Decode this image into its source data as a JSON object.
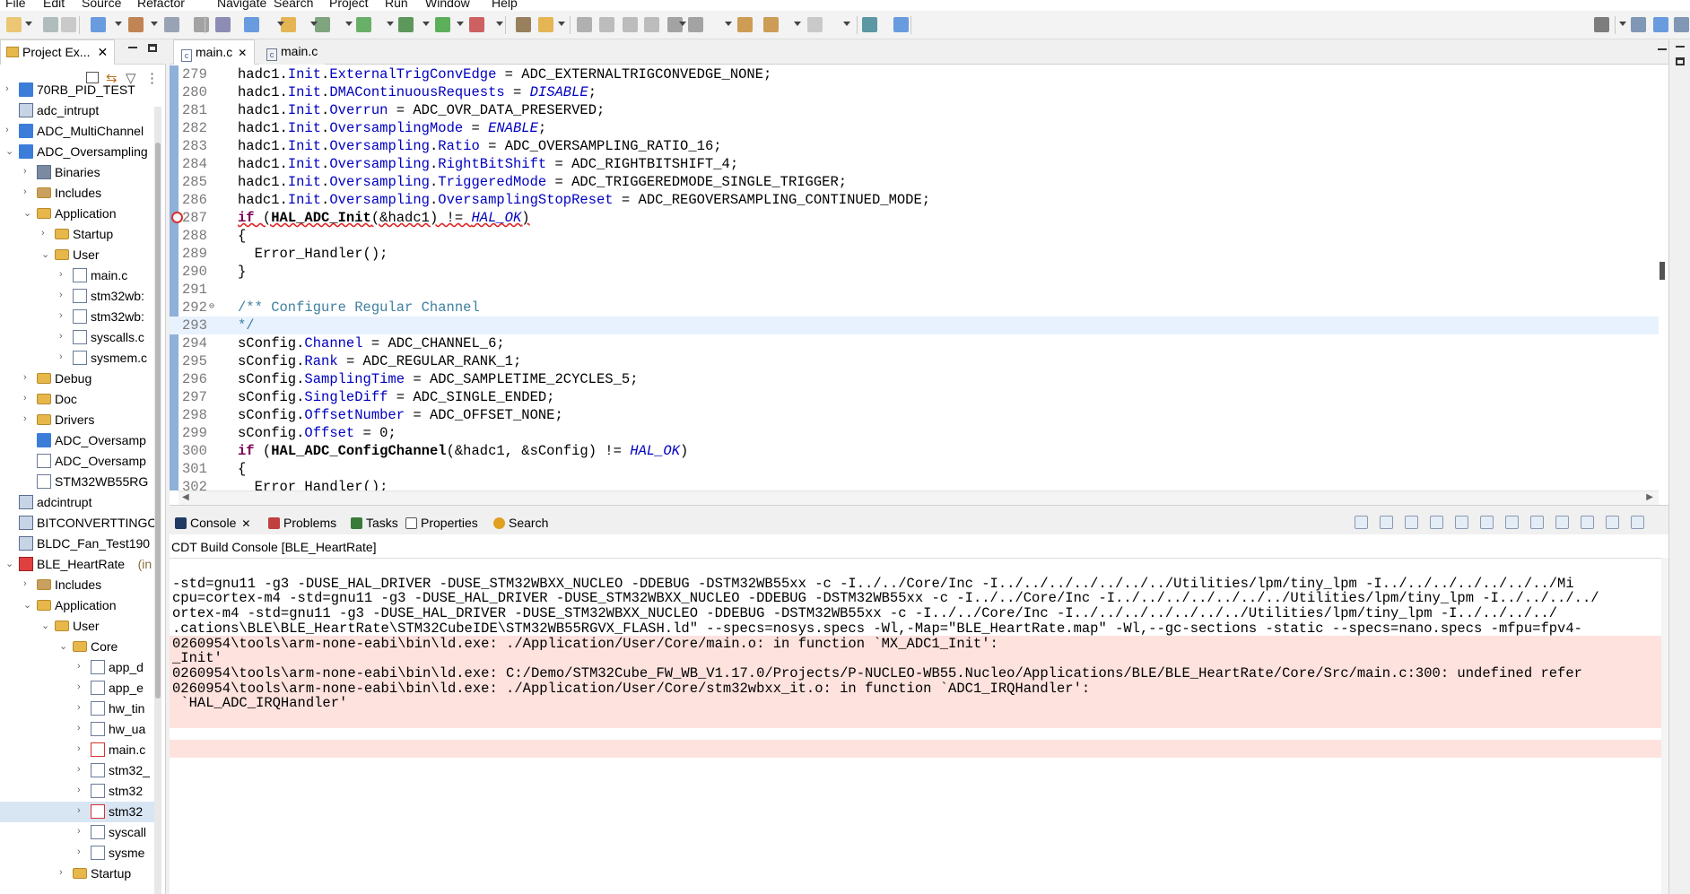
{
  "menu": [
    "File",
    "Edit",
    "Source",
    "Refactor",
    "Navigate",
    "Search",
    "Project",
    "Run",
    "Window",
    "Help"
  ],
  "explorer": {
    "tab_label": "Project Ex...",
    "items": [
      {
        "label": "70RB_PID_TEST",
        "indent": 0,
        "twisty": "›",
        "icon": "ide"
      },
      {
        "label": "adc_intrupt",
        "indent": 0,
        "twisty": "",
        "icon": "proj"
      },
      {
        "label": "ADC_MultiChannel",
        "indent": 0,
        "twisty": "›",
        "icon": "ide"
      },
      {
        "label": "ADC_Oversampling",
        "indent": 0,
        "twisty": "⌄",
        "icon": "ide"
      },
      {
        "label": "Binaries",
        "indent": 1,
        "twisty": "›",
        "icon": "bin"
      },
      {
        "label": "Includes",
        "indent": 1,
        "twisty": "›",
        "icon": "inc"
      },
      {
        "label": "Application",
        "indent": 1,
        "twisty": "⌄",
        "icon": "folder"
      },
      {
        "label": "Startup",
        "indent": 2,
        "twisty": "›",
        "icon": "folder"
      },
      {
        "label": "User",
        "indent": 2,
        "twisty": "⌄",
        "icon": "folder"
      },
      {
        "label": "main.c",
        "indent": 3,
        "twisty": "›",
        "icon": "cfile"
      },
      {
        "label": "stm32wb:",
        "indent": 3,
        "twisty": "›",
        "icon": "cfile"
      },
      {
        "label": "stm32wb:",
        "indent": 3,
        "twisty": "›",
        "icon": "cfile"
      },
      {
        "label": "syscalls.c",
        "indent": 3,
        "twisty": "›",
        "icon": "cfile"
      },
      {
        "label": "sysmem.c",
        "indent": 3,
        "twisty": "›",
        "icon": "cfile"
      },
      {
        "label": "Debug",
        "indent": 1,
        "twisty": "›",
        "icon": "folder"
      },
      {
        "label": "Doc",
        "indent": 1,
        "twisty": "›",
        "icon": "folder"
      },
      {
        "label": "Drivers",
        "indent": 1,
        "twisty": "›",
        "icon": "folder"
      },
      {
        "label": "ADC_Oversamp",
        "indent": 1,
        "twisty": "",
        "icon": "mx"
      },
      {
        "label": "ADC_Oversamp",
        "indent": 1,
        "twisty": "",
        "icon": "doc"
      },
      {
        "label": "STM32WB55RG",
        "indent": 1,
        "twisty": "",
        "icon": "doc"
      },
      {
        "label": "adcintrupt",
        "indent": 0,
        "twisty": "",
        "icon": "proj"
      },
      {
        "label": "BITCONVERTTINGC",
        "indent": 0,
        "twisty": "",
        "icon": "proj"
      },
      {
        "label": "BLDC_Fan_Test190",
        "indent": 0,
        "twisty": "",
        "icon": "proj"
      },
      {
        "label": "BLE_HeartRate",
        "indent": 0,
        "twisty": "⌄",
        "icon": "errproj",
        "decoration": "(in"
      },
      {
        "label": "Includes",
        "indent": 1,
        "twisty": "›",
        "icon": "inc"
      },
      {
        "label": "Application",
        "indent": 1,
        "twisty": "⌄",
        "icon": "folder"
      },
      {
        "label": "User",
        "indent": 2,
        "twisty": "⌄",
        "icon": "folder"
      },
      {
        "label": "Core",
        "indent": 3,
        "twisty": "⌄",
        "icon": "folder"
      },
      {
        "label": "app_d",
        "indent": 4,
        "twisty": "›",
        "icon": "cfile"
      },
      {
        "label": "app_e",
        "indent": 4,
        "twisty": "›",
        "icon": "cfile"
      },
      {
        "label": "hw_tin",
        "indent": 4,
        "twisty": "›",
        "icon": "cfile"
      },
      {
        "label": "hw_ua",
        "indent": 4,
        "twisty": "›",
        "icon": "cfile"
      },
      {
        "label": "main.c",
        "indent": 4,
        "twisty": "›",
        "icon": "cerr"
      },
      {
        "label": "stm32_",
        "indent": 4,
        "twisty": "›",
        "icon": "cfile"
      },
      {
        "label": "stm32",
        "indent": 4,
        "twisty": "›",
        "icon": "cfile"
      },
      {
        "label": "stm32",
        "indent": 4,
        "twisty": "›",
        "icon": "cerr",
        "selected": true
      },
      {
        "label": "syscall",
        "indent": 4,
        "twisty": "›",
        "icon": "cfile"
      },
      {
        "label": "sysme",
        "indent": 4,
        "twisty": "›",
        "icon": "cfile"
      },
      {
        "label": "Startup",
        "indent": 3,
        "twisty": "›",
        "icon": "folder"
      }
    ]
  },
  "editor": {
    "tabs": [
      "main.c",
      "main.c"
    ],
    "lines": [
      {
        "n": "279",
        "html": "hadc1.<span class='fld'>Init</span>.<span class='fld'>ExternalTrigConvEdge</span> = ADC_EXTERNALTRIGCONVEDGE_NONE;"
      },
      {
        "n": "280",
        "html": "hadc1.<span class='fld'>Init</span>.<span class='fld'>DMAContinuousRequests</span> = <span class='ital'>DISABLE</span>;"
      },
      {
        "n": "281",
        "html": "hadc1.<span class='fld'>Init</span>.<span class='fld'>Overrun</span> = ADC_OVR_DATA_PRESERVED;"
      },
      {
        "n": "282",
        "html": "hadc1.<span class='fld'>Init</span>.<span class='fld'>OversamplingMode</span> = <span class='ital'>ENABLE</span>;"
      },
      {
        "n": "283",
        "html": "hadc1.<span class='fld'>Init</span>.<span class='fld'>Oversampling</span>.<span class='fld'>Ratio</span> = ADC_OVERSAMPLING_RATIO_16;"
      },
      {
        "n": "284",
        "html": "hadc1.<span class='fld'>Init</span>.<span class='fld'>Oversampling</span>.<span class='fld'>RightBitShift</span> = ADC_RIGHTBITSHIFT_4;"
      },
      {
        "n": "285",
        "html": "hadc1.<span class='fld'>Init</span>.<span class='fld'>Oversampling</span>.<span class='fld'>TriggeredMode</span> = ADC_TRIGGEREDMODE_SINGLE_TRIGGER;"
      },
      {
        "n": "286",
        "html": "hadc1.<span class='fld'>Init</span>.<span class='fld'>Oversampling</span>.<span class='fld'>OversamplingStopReset</span> = ADC_REGOVERSAMPLING_CONTINUED_MODE;"
      },
      {
        "n": "287",
        "html": "<span class='errsq'><span class='kw'>if</span> (<b>HAL_ADC_Init</b>(&amp;hadc1) != <span class='ital'>HAL_OK</span>)</span>",
        "error": true
      },
      {
        "n": "288",
        "html": "{"
      },
      {
        "n": "289",
        "html": "  Error_Handler();"
      },
      {
        "n": "290",
        "html": "}"
      },
      {
        "n": "291",
        "html": ""
      },
      {
        "n": "292",
        "html": "<span class='cmt'>/** Configure Regular Channel</span>",
        "fold": true
      },
      {
        "n": "293",
        "html": "<span class='cmt'>*/</span>",
        "highlight": true
      },
      {
        "n": "294",
        "html": "sConfig.<span class='fld'>Channel</span> = ADC_CHANNEL_6;"
      },
      {
        "n": "295",
        "html": "sConfig.<span class='fld'>Rank</span> = ADC_REGULAR_RANK_1;"
      },
      {
        "n": "296",
        "html": "sConfig.<span class='fld'>SamplingTime</span> = ADC_SAMPLETIME_2CYCLES_5;"
      },
      {
        "n": "297",
        "html": "sConfig.<span class='fld'>SingleDiff</span> = ADC_SINGLE_ENDED;"
      },
      {
        "n": "298",
        "html": "sConfig.<span class='fld'>OffsetNumber</span> = ADC_OFFSET_NONE;"
      },
      {
        "n": "299",
        "html": "sConfig.<span class='fld'>Offset</span> = 0;"
      },
      {
        "n": "300",
        "html": "<span class='kw'>if</span> (<b>HAL_ADC_ConfigChannel</b>(&amp;hadc1, &amp;sConfig) != <span class='ital'>HAL_OK</span>)"
      },
      {
        "n": "301",
        "html": "{"
      },
      {
        "n": "302",
        "html": "  Error_Handler();"
      }
    ]
  },
  "console": {
    "tabs": [
      "Console",
      "Problems",
      "Tasks",
      "Properties",
      "Search"
    ],
    "title": "CDT Build Console [BLE_HeartRate]",
    "lines": [
      {
        "text": "",
        "error": false
      },
      {
        "text": "-std=gnu11 -g3 -DUSE_HAL_DRIVER -DUSE_STM32WBXX_NUCLEO -DDEBUG -DSTM32WB55xx -c -I../../Core/Inc -I../../../../../../../Utilities/lpm/tiny_lpm -I../../../../../../../Mi",
        "error": false
      },
      {
        "text": "cpu=cortex-m4 -std=gnu11 -g3 -DUSE_HAL_DRIVER -DUSE_STM32WBXX_NUCLEO -DDEBUG -DSTM32WB55xx -c -I../../Core/Inc -I../../../../../../../Utilities/lpm/tiny_lpm -I../../../../",
        "error": false
      },
      {
        "text": "ortex-m4 -std=gnu11 -g3 -DUSE_HAL_DRIVER -DUSE_STM32WBXX_NUCLEO -DDEBUG -DSTM32WB55xx -c -I../../Core/Inc -I../../../../../../../Utilities/lpm/tiny_lpm -I../../../../",
        "error": false
      },
      {
        "text": ".cations\\BLE\\BLE_HeartRate\\STM32CubeIDE\\STM32WB55RGVX_FLASH.ld\" --specs=nosys.specs -Wl,-Map=\"BLE_HeartRate.map\" -Wl,--gc-sections -static --specs=nano.specs -mfpu=fpv4-",
        "error": false
      },
      {
        "text": "0260954\\tools\\arm-none-eabi\\bin\\ld.exe: ./Application/User/Core/main.o: in function `MX_ADC1_Init':",
        "error": true
      },
      {
        "text": "_Init'",
        "error": true
      },
      {
        "text": "0260954\\tools\\arm-none-eabi\\bin\\ld.exe: C:/Demo/STM32Cube_FW_WB_V1.17.0/Projects/P-NUCLEO-WB55.Nucleo/Applications/BLE/BLE_HeartRate/Core/Src/main.c:300: undefined refer",
        "error": true
      },
      {
        "text": "0260954\\tools\\arm-none-eabi\\bin\\ld.exe: ./Application/User/Core/stm32wbxx_it.o: in function `ADC1_IRQHandler':",
        "error": true
      },
      {
        "text": " `HAL_ADC_IRQHandler'",
        "error": true
      },
      {
        "text": "",
        "error": true
      },
      {
        "text": "",
        "error": false
      },
      {
        "text": "",
        "error": true
      }
    ]
  },
  "colors": {
    "accent": "#3b7dd8",
    "error": "#d83030",
    "console_error_bg": "#fde2de",
    "highlight_line": "#e8f2fe"
  }
}
